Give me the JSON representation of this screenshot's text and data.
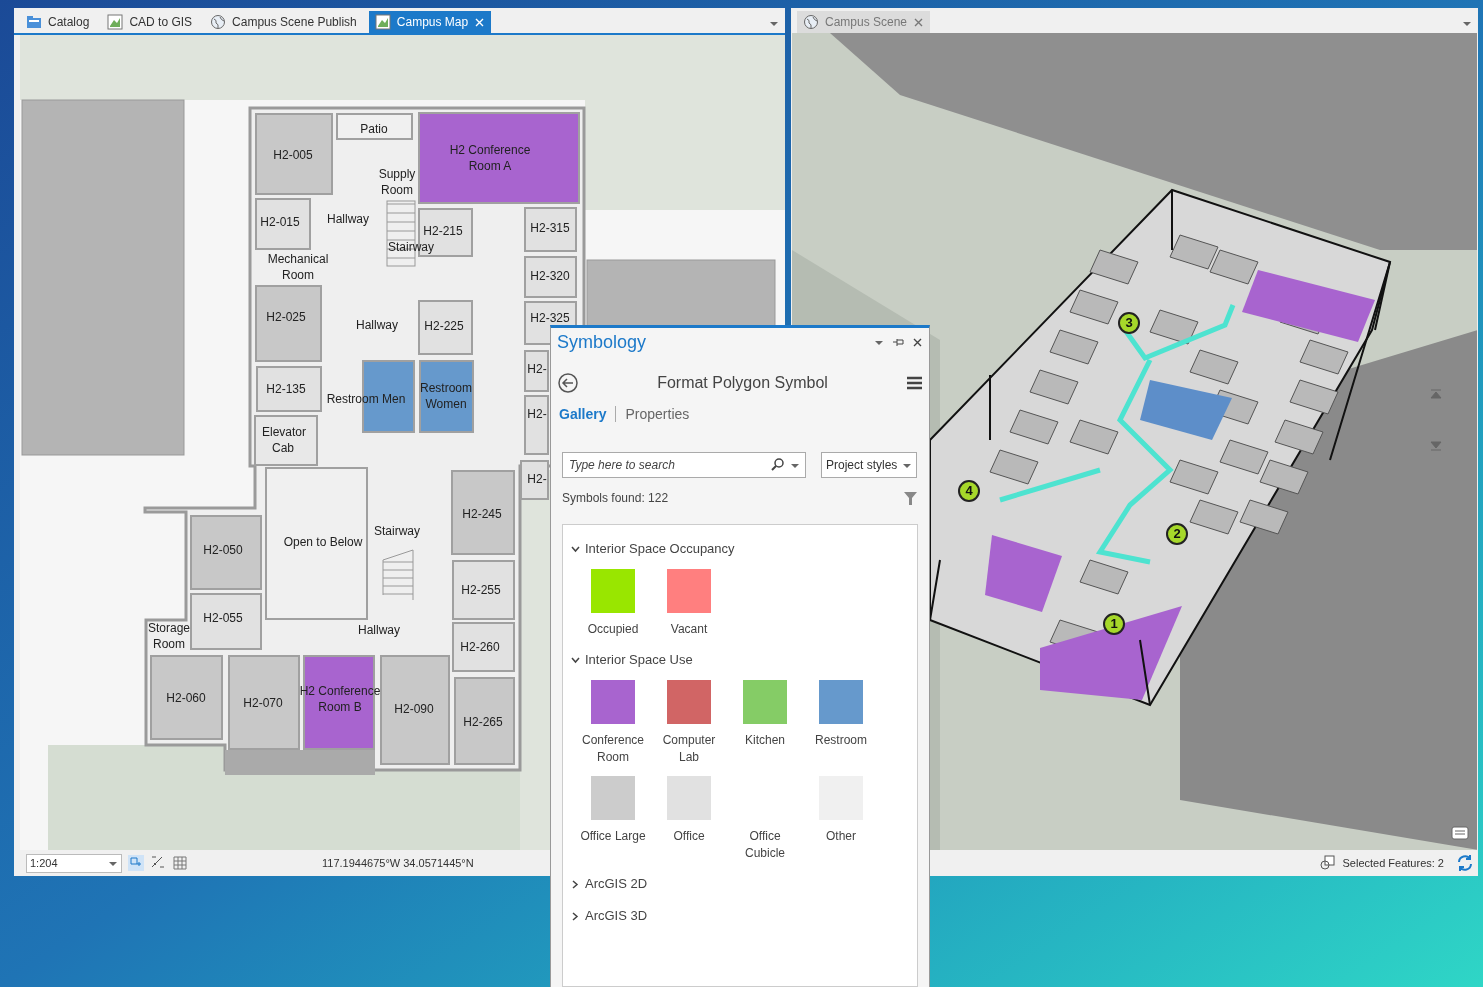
{
  "left_pane": {
    "tabs": [
      {
        "label": "Catalog",
        "kind": "catalog",
        "selected": false,
        "closable": false
      },
      {
        "label": "CAD to GIS",
        "kind": "map",
        "selected": false,
        "closable": false
      },
      {
        "label": "Campus Scene Publish",
        "kind": "globe",
        "selected": false,
        "closable": false
      },
      {
        "label": "Campus Map",
        "kind": "map",
        "selected": true,
        "closable": true
      }
    ],
    "map": {
      "rooms": [
        {
          "label": "Patio",
          "color": "#f0f0f0"
        },
        {
          "label": "H2-005",
          "color": "#c8c8c8"
        },
        {
          "label": "H2 Conference Room A",
          "color": "#a864cf"
        },
        {
          "label": "Supply Room"
        },
        {
          "label": "H2-015",
          "color": "#e1e1e1"
        },
        {
          "label": "Hallway"
        },
        {
          "label": "Stairway"
        },
        {
          "label": "H2-215",
          "color": "#e1e1e1"
        },
        {
          "label": "H2-315",
          "color": "#e1e1e1"
        },
        {
          "label": "Mechanical Room"
        },
        {
          "label": "H2-320",
          "color": "#e1e1e1"
        },
        {
          "label": "H2-025",
          "color": "#c8c8c8"
        },
        {
          "label": "Hallway"
        },
        {
          "label": "H2-225",
          "color": "#e1e1e1"
        },
        {
          "label": "H2-325",
          "color": "#e1e1e1"
        },
        {
          "label": "H2-135",
          "color": "#e1e1e1"
        },
        {
          "label": "Restroom Men",
          "color": "#6699cc"
        },
        {
          "label": "Restroom Women",
          "color": "#6699cc"
        },
        {
          "label": "H2-",
          "color": "#e1e1e1"
        },
        {
          "label": "H2-",
          "color": "#e1e1e1"
        },
        {
          "label": "Elevator Cab",
          "color": "#e8e8e8"
        },
        {
          "label": "H2-245",
          "color": "#c8c8c8"
        },
        {
          "label": "H2-",
          "color": "#e1e1e1"
        },
        {
          "label": "Open to Below",
          "color": "#f0f0f0"
        },
        {
          "label": "Stairway"
        },
        {
          "label": "H2-050",
          "color": "#c8c8c8"
        },
        {
          "label": "H2-055",
          "color": "#e1e1e1"
        },
        {
          "label": "H2-255",
          "color": "#e1e1e1"
        },
        {
          "label": "Hallway"
        },
        {
          "label": "H2-260",
          "color": "#e1e1e1"
        },
        {
          "label": "Storage Room"
        },
        {
          "label": "H2-060",
          "color": "#c8c8c8"
        },
        {
          "label": "H2-070",
          "color": "#c8c8c8"
        },
        {
          "label": "H2 Conference Room B",
          "color": "#a864cf"
        },
        {
          "label": "H2-090",
          "color": "#c8c8c8"
        },
        {
          "label": "H2-265",
          "color": "#c8c8c8"
        }
      ]
    },
    "status_bar": {
      "scale": "1:204",
      "coordinates": "117.1944675°W 34.0571445°N"
    }
  },
  "right_pane": {
    "tabs": [
      {
        "label": "Campus Scene",
        "kind": "globe",
        "selected": false,
        "closable": true
      }
    ],
    "scene": {
      "markers": [
        {
          "label": "3"
        },
        {
          "label": "4"
        },
        {
          "label": "2"
        },
        {
          "label": "1"
        }
      ]
    },
    "status_bar": {
      "selection": "Selected Features: 2"
    }
  },
  "symbology": {
    "title": "Symbology",
    "heading": "Format Polygon Symbol",
    "tabs": [
      {
        "label": "Gallery",
        "selected": true
      },
      {
        "label": "Properties",
        "selected": false
      }
    ],
    "search": {
      "placeholder": "Type here to search"
    },
    "styles": "Project styles",
    "found": "Symbols found: 122",
    "groups": [
      {
        "title": "Interior Space Occupancy",
        "expanded": true,
        "symbols": [
          {
            "label": "Occupied",
            "color": "#99e600"
          },
          {
            "label": "Vacant",
            "color": "#ff7f7f"
          }
        ]
      },
      {
        "title": "Interior Space Use",
        "expanded": true,
        "symbols": [
          {
            "label": "Conference Room",
            "color": "#a864cf"
          },
          {
            "label": "Computer Lab",
            "color": "#d16565"
          },
          {
            "label": "Kitchen",
            "color": "#85cc66"
          },
          {
            "label": "Restroom",
            "color": "#6699cc"
          },
          {
            "label": "Office Large",
            "color": "#cccccc"
          },
          {
            "label": "Office",
            "color": "#e1e1e1"
          },
          {
            "label": "Office Cubicle"
          },
          {
            "label": "Other",
            "color": "#f0f0f0"
          }
        ]
      },
      {
        "title": "ArcGIS 2D",
        "expanded": false
      },
      {
        "title": "ArcGIS 3D",
        "expanded": false
      }
    ]
  }
}
